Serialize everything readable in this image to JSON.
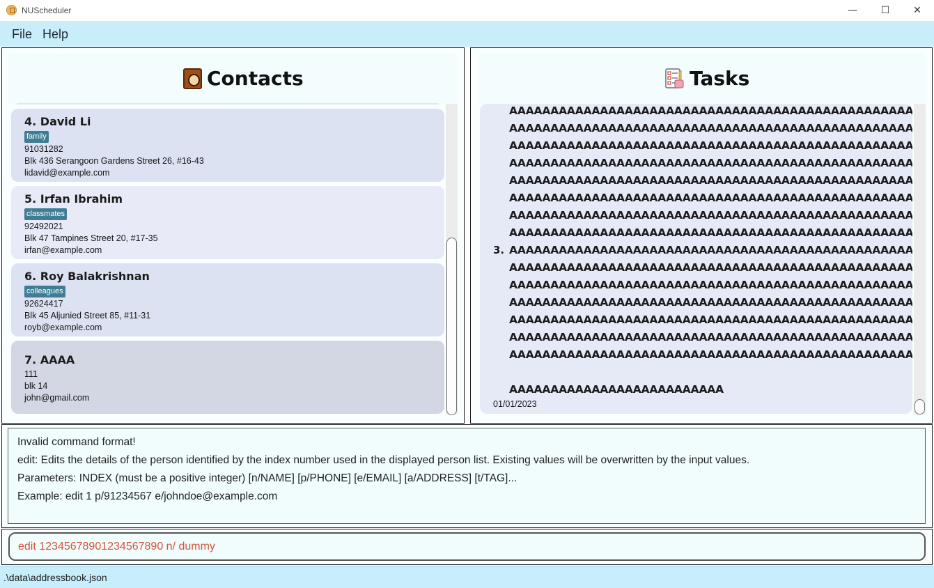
{
  "window": {
    "title": "NUScheduler"
  },
  "menu": {
    "items": [
      "File",
      "Help"
    ]
  },
  "contacts": {
    "header": "Contacts",
    "items": [
      {
        "name": "4.  David Li",
        "tag": "family",
        "phone": "91031282",
        "address": "Blk 436 Serangoon Gardens Street 26, #16-43",
        "email": "lidavid@example.com"
      },
      {
        "name": "5.  Irfan Ibrahim",
        "tag": "classmates",
        "phone": "92492021",
        "address": "Blk 47 Tampines Street 20, #17-35",
        "email": "irfan@example.com"
      },
      {
        "name": "6.  Roy Balakrishnan",
        "tag": "colleagues",
        "phone": "92624417",
        "address": "Blk 45 Aljunied Street 85, #11-31",
        "email": "royb@example.com"
      },
      {
        "name": "7.  AAAA",
        "tag": "",
        "phone": "111",
        "address": "blk 14",
        "email": "john@gmail.com"
      }
    ]
  },
  "tasks": {
    "header": "Tasks",
    "index": "3.",
    "lines": [
      "AAAAAAAAAAAAAAAAAAAAAAAAAAAAAAAAAAAAAAAAAAAAAAAAA",
      "AAAAAAAAAAAAAAAAAAAAAAAAAAAAAAAAAAAAAAAAAAAAAAAAA",
      "AAAAAAAAAAAAAAAAAAAAAAAAAAAAAAAAAAAAAAAAAAAAAAAAA",
      "AAAAAAAAAAAAAAAAAAAAAAAAAAAAAAAAAAAAAAAAAAAAAAAAA",
      "AAAAAAAAAAAAAAAAAAAAAAAAAAAAAAAAAAAAAAAAAAAAAAAAA",
      "AAAAAAAAAAAAAAAAAAAAAAAAAAAAAAAAAAAAAAAAAAAAAAAAA",
      "AAAAAAAAAAAAAAAAAAAAAAAAAAAAAAAAAAAAAAAAAAAAAAAAA",
      "AAAAAAAAAAAAAAAAAAAAAAAAAAAAAAAAAAAAAAAAAAAAAAAAA",
      "AAAAAAAAAAAAAAAAAAAAAAAAAAAAAAAAAAAAAAAAAAAAAAAAA",
      "AAAAAAAAAAAAAAAAAAAAAAAAAAAAAAAAAAAAAAAAAAAAAAAAA",
      "AAAAAAAAAAAAAAAAAAAAAAAAAAAAAAAAAAAAAAAAAAAAAAAAA",
      "AAAAAAAAAAAAAAAAAAAAAAAAAAAAAAAAAAAAAAAAAAAAAAAAA",
      "AAAAAAAAAAAAAAAAAAAAAAAAAAAAAAAAAAAAAAAAAAAAAAAAA",
      "AAAAAAAAAAAAAAAAAAAAAAAAAAAAAAAAAAAAAAAAAAAAAAAAA",
      "AAAAAAAAAAAAAAAAAAAAAAAAAAAAAAAAAAAAAAAAAAAAAAAAA",
      "AAAAAAAAAAAAAAAAAAAAAAAAAA"
    ],
    "date": "01/01/2023"
  },
  "result": {
    "lines": [
      "Invalid command format!",
      "edit: Edits the details of the person identified by the index number used in the displayed person list. Existing values will be overwritten by the input values.",
      "Parameters: INDEX (must be a positive integer) [n/NAME] [p/PHONE] [e/EMAIL] [a/ADDRESS] [t/TAG]...",
      "Example: edit 1 p/91234567 e/johndoe@example.com"
    ]
  },
  "command": {
    "value": "edit 12345678901234567890 n/ dummy"
  },
  "status": {
    "path": ".\\data\\addressbook.json"
  }
}
